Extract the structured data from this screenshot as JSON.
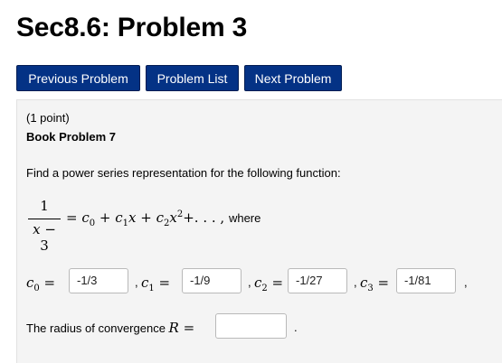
{
  "header": {
    "title": "Sec8.6: Problem 3"
  },
  "nav": {
    "previous_label": "Previous Problem",
    "list_label": "Problem List",
    "next_label": "Next Problem"
  },
  "problem": {
    "points": "(1 point)",
    "book_label": "Book Problem 7",
    "question": "Find a power series representation for the following function:",
    "equation": {
      "numerator": "1",
      "denominator_var": "x",
      "denominator_rest": " − 3",
      "series_prefix": " = ",
      "series_ellipsis": "+. . . ,",
      "where_text": "where"
    },
    "answers": [
      {
        "label": "c",
        "index": "0",
        "value": "-1/3"
      },
      {
        "label": "c",
        "index": "1",
        "value": "-1/9"
      },
      {
        "label": "c",
        "index": "2",
        "value": "-1/27"
      },
      {
        "label": "c",
        "index": "3",
        "value": "-1/81"
      }
    ],
    "radius": {
      "text": "The radius of convergence ",
      "symbol": "R",
      "value": "",
      "period": "."
    }
  },
  "colors": {
    "button_bg": "#043285",
    "button_text": "#ffffff",
    "panel_bg": "#f4f4f4"
  }
}
